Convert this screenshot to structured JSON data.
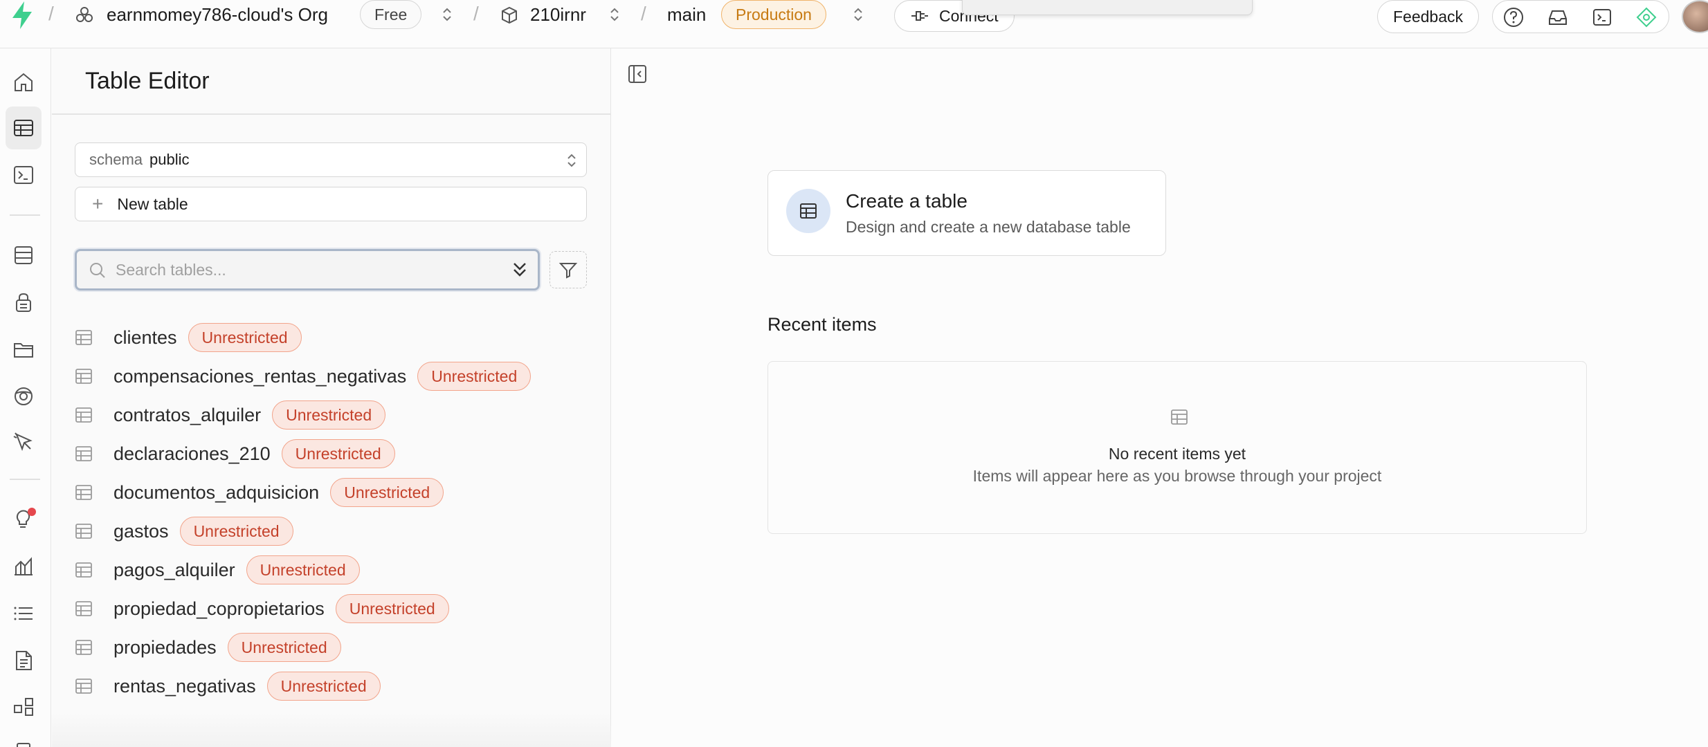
{
  "topbar": {
    "org_name": "earnmomey786-cloud's Org",
    "plan_badge": "Free",
    "project_name": "210irnr",
    "branch_name": "main",
    "env_badge": "Production",
    "connect_label": "Connect",
    "feedback_label": "Feedback",
    "separator": "/"
  },
  "rail": {
    "icons": [
      "home-icon",
      "table-editor-icon",
      "sql-editor-icon",
      "database-icon",
      "auth-icon",
      "storage-icon",
      "realtime-icon",
      "edge-functions-icon",
      "advisors-icon",
      "reports-icon",
      "logs-icon",
      "api-docs-icon",
      "integrations-icon",
      "settings-icon"
    ]
  },
  "panel": {
    "title": "Table Editor",
    "schema_label": "schema",
    "schema_value": "public",
    "new_table_label": "New table",
    "search_placeholder": "Search tables...",
    "tables": [
      {
        "name": "clientes",
        "badge": "Unrestricted"
      },
      {
        "name": "compensaciones_rentas_negativas",
        "badge": "Unrestricted"
      },
      {
        "name": "contratos_alquiler",
        "badge": "Unrestricted"
      },
      {
        "name": "declaraciones_210",
        "badge": "Unrestricted"
      },
      {
        "name": "documentos_adquisicion",
        "badge": "Unrestricted"
      },
      {
        "name": "gastos",
        "badge": "Unrestricted"
      },
      {
        "name": "pagos_alquiler",
        "badge": "Unrestricted"
      },
      {
        "name": "propiedad_copropietarios",
        "badge": "Unrestricted"
      },
      {
        "name": "propiedades",
        "badge": "Unrestricted"
      },
      {
        "name": "rentas_negativas",
        "badge": "Unrestricted"
      }
    ]
  },
  "main": {
    "create_title": "Create a table",
    "create_subtitle": "Design and create a new database table",
    "recent_heading": "Recent items",
    "recent_empty_title": "No recent items yet",
    "recent_empty_subtitle": "Items will appear here as you browse through your project"
  },
  "colors": {
    "brand": "#3ecf8e",
    "production_badge": "#c77a12",
    "unrestricted_badge": "#c4412a",
    "focus_ring": "#a9b6c8"
  }
}
